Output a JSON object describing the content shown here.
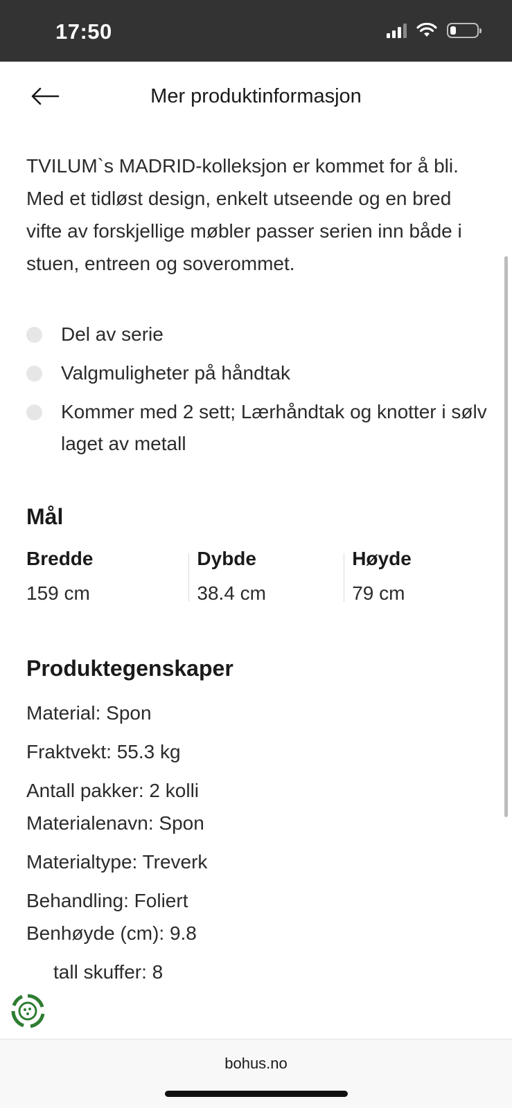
{
  "status_bar": {
    "time": "17:50",
    "battery_level": 0.2
  },
  "header": {
    "title": "Mer produktinformasjon",
    "back_icon": "arrow-left-icon"
  },
  "description": "TVILUM`s MADRID-kolleksjon er kommet for å bli. Med et tidløst design, enkelt utseende og en bred vifte av forskjellige møbler passer serien inn både i stuen, entreen og soverommet.",
  "features": [
    "Del av serie",
    "Valgmuligheter på håndtak",
    "Kommer med 2 sett; Lærhåndtak og knotter i sølv laget av metall"
  ],
  "dimensions": {
    "title": "Mål",
    "items": [
      {
        "label": "Bredde",
        "value": "159 cm"
      },
      {
        "label": "Dybde",
        "value": "38.4 cm"
      },
      {
        "label": "Høyde",
        "value": "79 cm"
      }
    ]
  },
  "properties": {
    "title": "Produktegenskaper",
    "items": [
      "Material: Spon",
      "Fraktvekt: 55.3 kg",
      "Antall pakker: 2 kolli",
      "Materialenavn: Spon",
      "Materialtype: Treverk",
      "Behandling: Foliert",
      "Benhøyde (cm): 9.8",
      "tall skuffer: 8"
    ]
  },
  "browser": {
    "url": "bohus.no"
  },
  "colors": {
    "status_bar": "#333333",
    "eco_badge": "#2e7d32",
    "bullet": "#e6e6e6"
  }
}
